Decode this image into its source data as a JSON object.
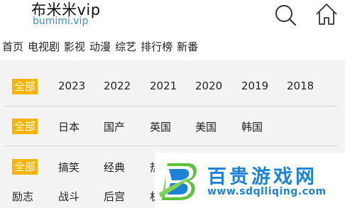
{
  "header": {
    "site_name": "布米米vip",
    "site_domain": "bumimi.vip",
    "icons": {
      "search": "search-icon",
      "home": "home-icon"
    }
  },
  "nav": {
    "items": [
      "首页",
      "电视剧",
      "影视",
      "动漫",
      "综艺",
      "排行榜",
      "新番"
    ]
  },
  "filters": {
    "years": {
      "all_label": "全部",
      "options": [
        "2023",
        "2022",
        "2021",
        "2020",
        "2019",
        "2018"
      ]
    },
    "regions": {
      "all_label": "全部",
      "options": [
        "日本",
        "国产",
        "英国",
        "美国",
        "韩国"
      ]
    },
    "genres": {
      "all_label": "全部",
      "row1": [
        "搞笑",
        "经典",
        "热"
      ],
      "row2": [
        "励志",
        "战斗",
        "后宫",
        "机"
      ]
    }
  },
  "watermark": {
    "title": "百贵游戏网",
    "url": "www.sdqlliqing.com"
  },
  "colors": {
    "active_chip": "#f6b400",
    "domain_text": "#3a8ee6",
    "watermark_blue": "#1c83d8",
    "panel_bg": "#f3f3f3"
  }
}
